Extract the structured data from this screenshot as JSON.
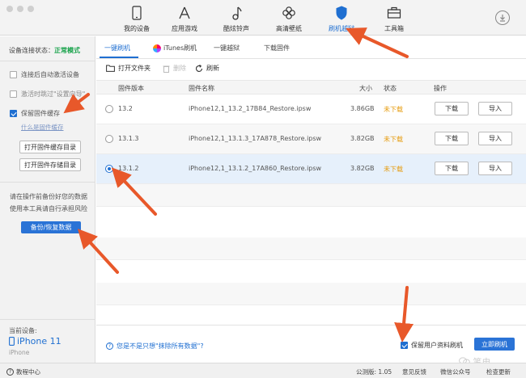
{
  "colors": {
    "accent": "#1f6fd1",
    "success": "#17a24a",
    "warning": "#e69b0c",
    "arrow": "#e8582a"
  },
  "nav": [
    {
      "label": "我的设备",
      "icon": "phone-icon"
    },
    {
      "label": "应用游戏",
      "icon": "app-store-icon"
    },
    {
      "label": "酷炫铃声",
      "icon": "music-note-icon"
    },
    {
      "label": "高清壁纸",
      "icon": "flower-icon"
    },
    {
      "label": "刷机越狱",
      "icon": "shield-icon",
      "active": true
    },
    {
      "label": "工具箱",
      "icon": "toolbox-icon"
    }
  ],
  "sidebar": {
    "status_label": "设备连接状态：",
    "status_value": "正常模式",
    "auto_activate": "连接后自动激活设备",
    "skip_setup": "激活时跳过\"设置向导\"",
    "keep_cache": "保留固件缓存",
    "what_cache": "什么是固件缓存",
    "open_cache_dir": "打开固件缓存目录",
    "open_store_dir": "打开固件存储目录",
    "warn_line1": "请在操作前备份好您的数据",
    "warn_line2": "使用本工具请自行承担风险",
    "backup_button": "备份/恢复数据",
    "device_title": "当前设备:",
    "device_name": "iPhone 11",
    "device_sub": "iPhone"
  },
  "tabs": [
    "一键刷机",
    "iTunes刷机",
    "一键越狱",
    "下载固件"
  ],
  "actions": {
    "open_folder": "打开文件夹",
    "delete": "删除",
    "refresh": "刷新"
  },
  "table": {
    "headers": [
      "固件版本",
      "固件名称",
      "大小",
      "状态",
      "操作"
    ],
    "rows": [
      {
        "version": "13.2",
        "name": "iPhone12,1_13.2_17B84_Restore.ipsw",
        "size": "3.86GB",
        "status": "未下载",
        "download": "下载",
        "import": "导入"
      },
      {
        "version": "13.1.3",
        "name": "iPhone12,1_13.1.3_17A878_Restore.ipsw",
        "size": "3.82GB",
        "status": "未下载",
        "download": "下载",
        "import": "导入"
      },
      {
        "version": "13.1.2",
        "name": "iPhone12,1_13.1.2_17A860_Restore.ipsw",
        "size": "3.82GB",
        "status": "未下载",
        "download": "下载",
        "import": "导入"
      }
    ]
  },
  "bottom": {
    "erase_question": "您是不是只想\"抹除所有数据\"?",
    "keep_data": "保留用户资料刷机",
    "flash_now": "立即刷机",
    "watermark": "笔电"
  },
  "statusbar": {
    "tutorial": "教程中心",
    "version": "公测版: 1.05",
    "feedback": "意见反馈",
    "wechat": "微信公众号",
    "check_update": "检查更新"
  }
}
